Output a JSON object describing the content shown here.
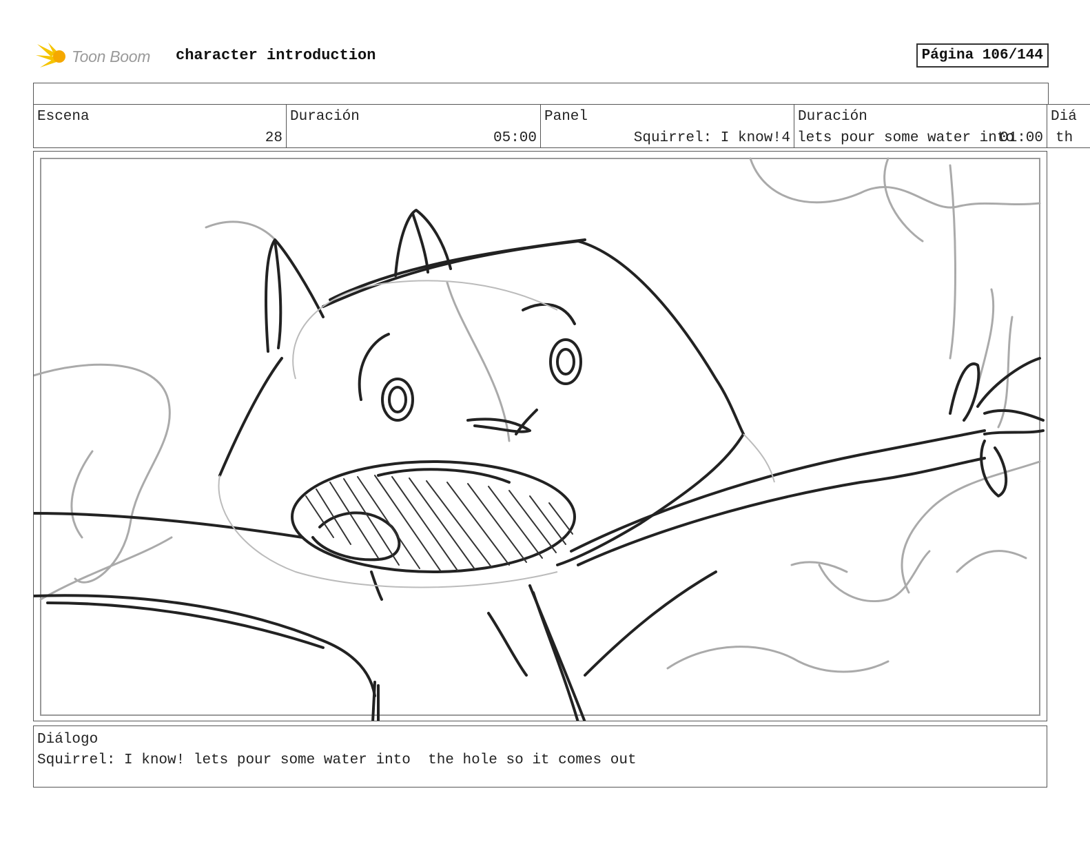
{
  "header": {
    "logo_text": "Toon Boom",
    "title": "character introduction",
    "page": "Página 106/144"
  },
  "info": {
    "scene_label": "Escena",
    "scene_value": "28",
    "scene_duration_label": "Duración",
    "scene_duration_value": "05:00",
    "panel_label": "Panel",
    "panel_value": "4",
    "panel_overlap_text": "Squirrel: I know!",
    "panel_duration_label": "Duración",
    "panel_duration_value": "01:00",
    "panel_duration_overlap_text": "lets pour some water into",
    "dialog_label_cut": "Diá",
    "dialog_text_cut": "th"
  },
  "dialog": {
    "label": "Diálogo",
    "text": "Squirrel: I know! lets pour some water into  the hole so it comes out"
  },
  "colors": {
    "border": "#555555",
    "sketch_dark": "#222222",
    "sketch_light": "#aaaaaa",
    "logo_yellow": "#f5c400"
  }
}
